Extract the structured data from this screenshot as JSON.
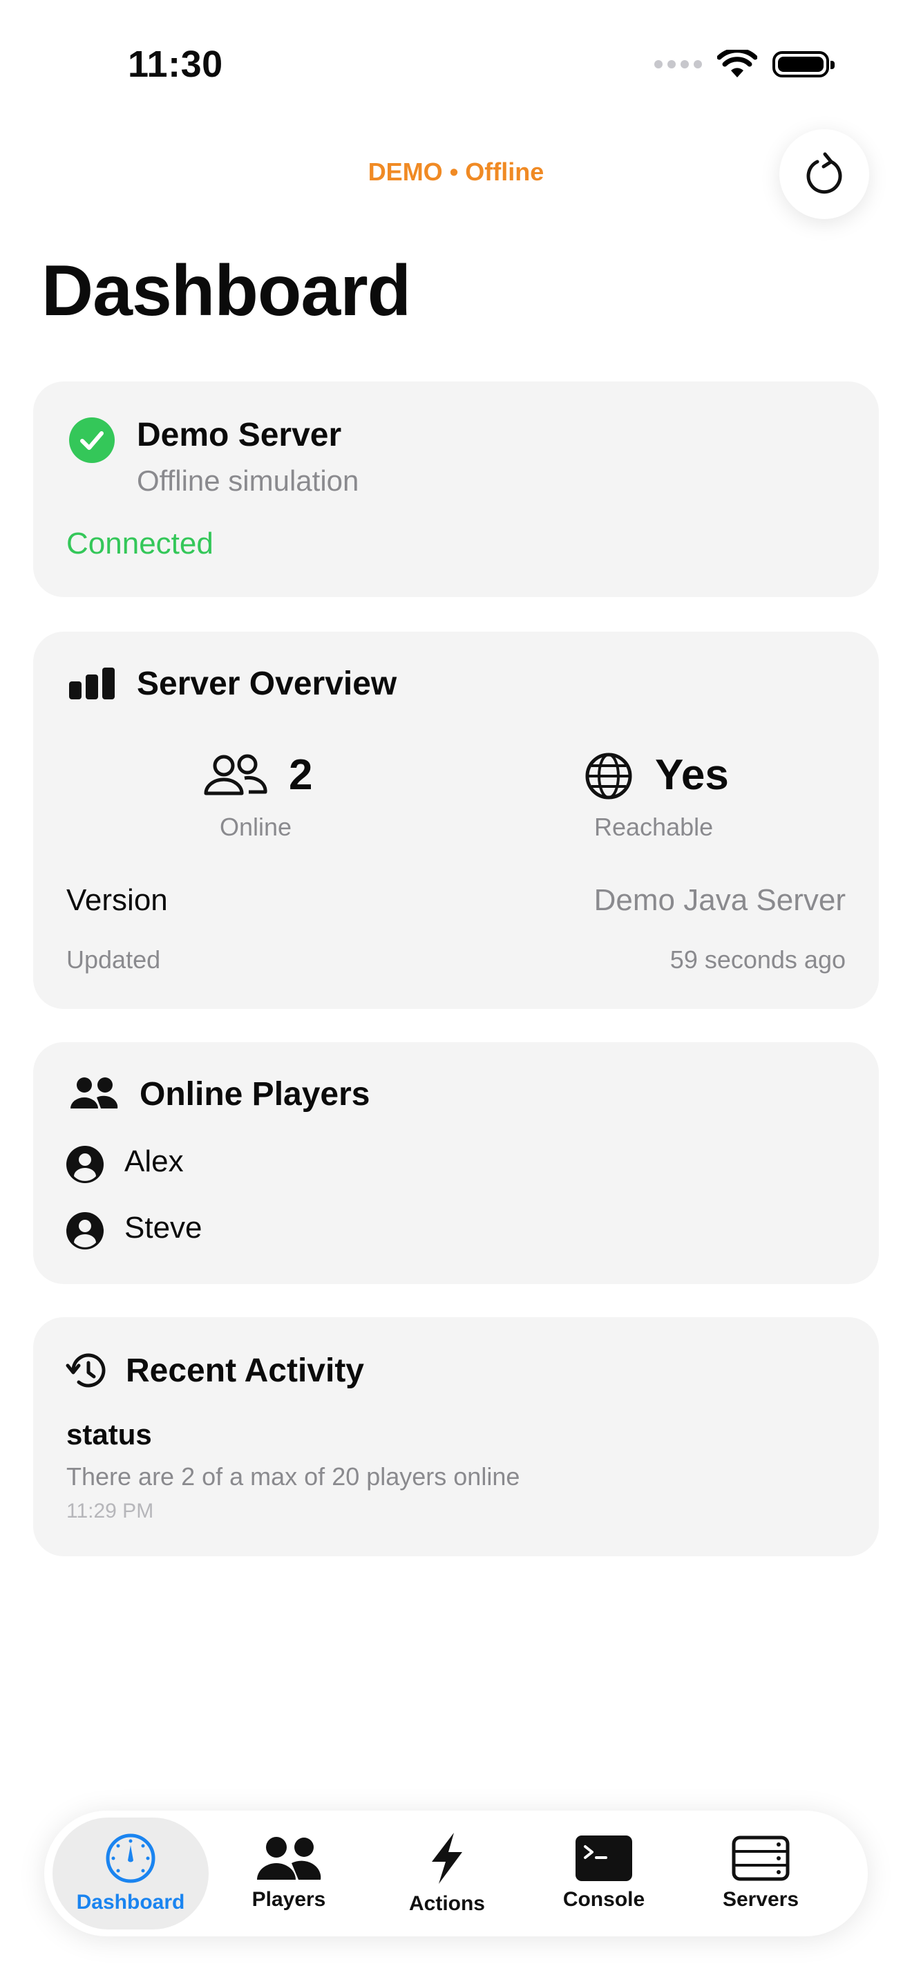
{
  "status_bar": {
    "time": "11:30"
  },
  "nav": {
    "mode_label": "DEMO • Offline"
  },
  "page": {
    "title": "Dashboard"
  },
  "server_card": {
    "name": "Demo Server",
    "subtitle": "Offline simulation",
    "status": "Connected",
    "status_color": "#34c759"
  },
  "overview": {
    "title": "Server Overview",
    "online_count": "2",
    "online_label": "Online",
    "reachable_value": "Yes",
    "reachable_label": "Reachable",
    "version_label": "Version",
    "version_value": "Demo Java Server",
    "updated_label": "Updated",
    "updated_value": "59 seconds ago"
  },
  "players": {
    "title": "Online Players",
    "items": [
      {
        "name": "Alex"
      },
      {
        "name": "Steve"
      }
    ]
  },
  "activity": {
    "title": "Recent Activity",
    "entries": [
      {
        "command": "status",
        "output": "There are 2 of a max of 20 players online",
        "time": "11:29 PM"
      }
    ]
  },
  "tabbar": {
    "tabs": [
      {
        "label": "Dashboard",
        "icon": "gauge-icon",
        "active": true
      },
      {
        "label": "Players",
        "icon": "people-icon"
      },
      {
        "label": "Actions",
        "icon": "bolt-icon"
      },
      {
        "label": "Console",
        "icon": "terminal-icon"
      },
      {
        "label": "Servers",
        "icon": "server-rack-icon"
      }
    ],
    "accent_color": "#1a84f0"
  }
}
